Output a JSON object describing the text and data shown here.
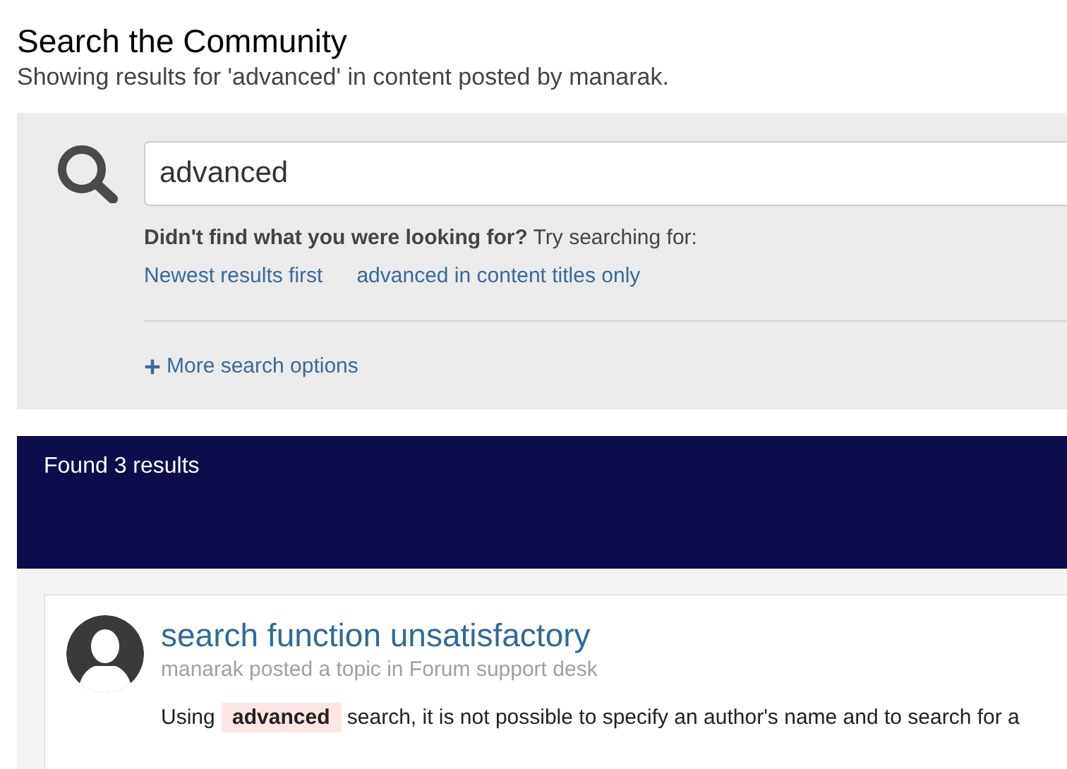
{
  "header": {
    "title": "Search the Community",
    "subtitle": "Showing results for 'advanced' in content posted by manarak."
  },
  "search": {
    "value": "advanced",
    "hint_bold": "Didn't find what you were looking for?",
    "hint": "Try searching for:",
    "suggestions": [
      "Newest results first",
      "advanced in content titles only"
    ],
    "more_options": "More search options"
  },
  "results": {
    "heading": "Found 3 results",
    "items": [
      {
        "title": "search function unsatisfactory",
        "meta": "manarak posted a topic in Forum support desk",
        "snippet_before": "Using",
        "highlight": "advanced",
        "snippet_after": "search, it is not possible to specify an author's name and to search for a"
      }
    ]
  }
}
